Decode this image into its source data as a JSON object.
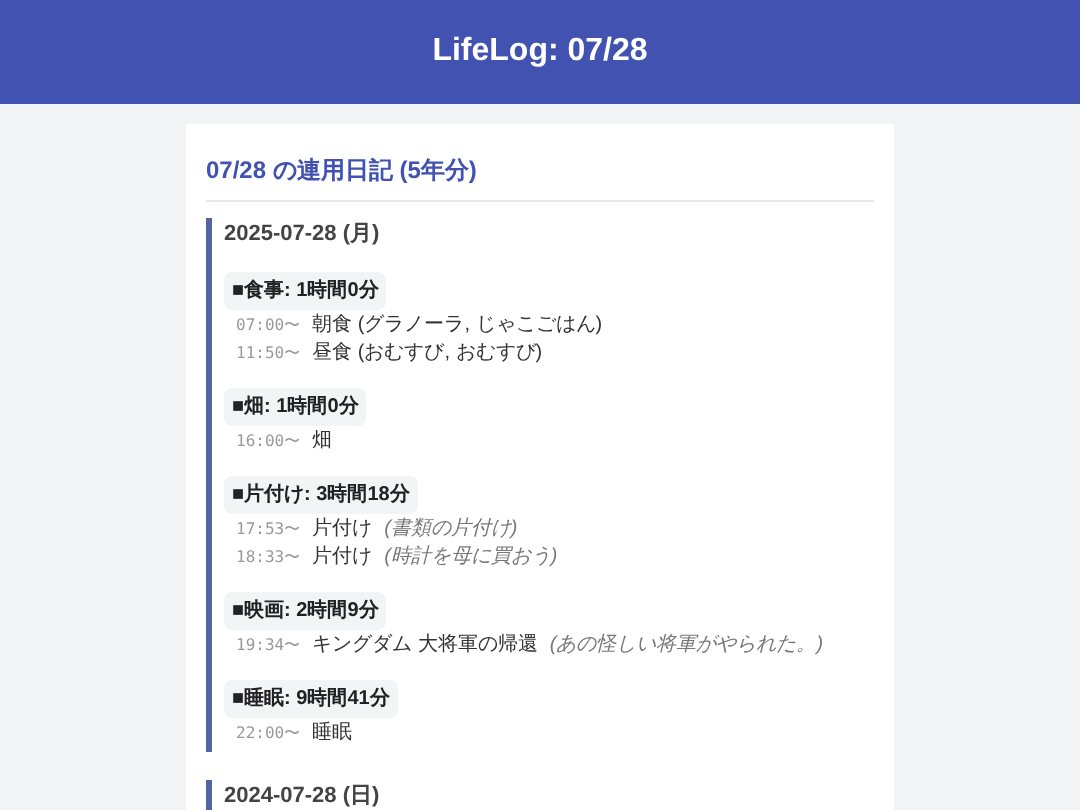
{
  "header": {
    "title": "LifeLog: 07/28"
  },
  "card": {
    "title": "07/28 の連用日記 (5年分)",
    "days": [
      {
        "date": "2025-07-28 (月)",
        "categories": [
          {
            "label": "■食事: 1時間0分",
            "entries": [
              {
                "time": "07:00〜",
                "text": "朝食 (グラノーラ, じゃこごはん)"
              },
              {
                "time": "11:50〜",
                "text": "昼食 (おむすび, おむすび)"
              }
            ]
          },
          {
            "label": "■畑: 1時間0分",
            "entries": [
              {
                "time": "16:00〜",
                "text": "畑"
              }
            ]
          },
          {
            "label": "■片付け: 3時間18分",
            "entries": [
              {
                "time": "17:53〜",
                "text": "片付け",
                "note": "(書類の片付け)"
              },
              {
                "time": "18:33〜",
                "text": "片付け",
                "note": "(時計を母に買おう)"
              }
            ]
          },
          {
            "label": "■映画: 2時間9分",
            "entries": [
              {
                "time": "19:34〜",
                "text": "キングダム 大将軍の帰還",
                "note": "(あの怪しい将軍がやられた。)"
              }
            ]
          },
          {
            "label": "■睡眠: 9時間41分",
            "entries": [
              {
                "time": "22:00〜",
                "text": "睡眠"
              }
            ]
          }
        ]
      },
      {
        "date": "2024-07-28 (日)"
      }
    ]
  }
}
